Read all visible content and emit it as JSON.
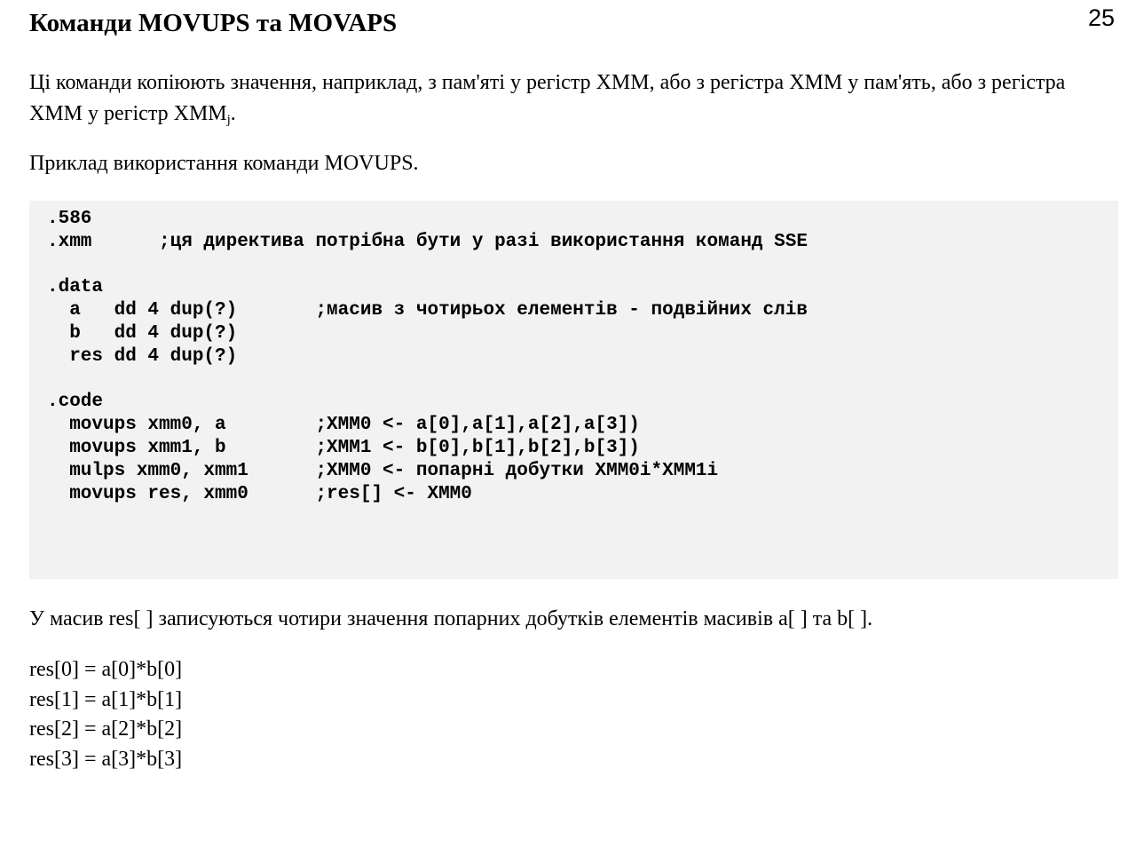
{
  "page_number": "25",
  "title": "Команди MOVUPS та MOVAPS",
  "intro": {
    "text": "Ці команди копіюють значення, наприклад, з пам'яті у регістр XMM,  або з регістра XMM у пам'ять, або з регістра XMM  у регістр XMM",
    "subscript": "j",
    "tail": "."
  },
  "example_label": "Приклад використання  команди MOVUPS.",
  "code_lines": [
    ".586",
    ".xmm      ;ця директива потрібна бути у разі використання команд SSE",
    "",
    ".data",
    "  a   dd 4 dup(?)       ;масив з чотирьох елементів - подвійних слів",
    "  b   dd 4 dup(?)",
    "  res dd 4 dup(?)",
    "",
    ".code",
    "  movups xmm0, a        ;XMM0 <- a[0],a[1],a[2],a[3])",
    "  movups xmm1, b        ;XMM1 <- b[0],b[1],b[2],b[3])",
    "  mulps xmm0, xmm1      ;XMM0 <- попарні добутки XMM0i*XMM1i",
    "  movups res, xmm0      ;res[] <- XMM0"
  ],
  "summary": "У масив res[ ] записуються чотири значення попарних добутків елементів масивів a[ ] та b[ ].",
  "formulas": [
    "res[0] = a[0]*b[0]",
    "res[1] = a[1]*b[1]",
    "res[2] = a[2]*b[2]",
    "res[3] = a[3]*b[3]"
  ]
}
